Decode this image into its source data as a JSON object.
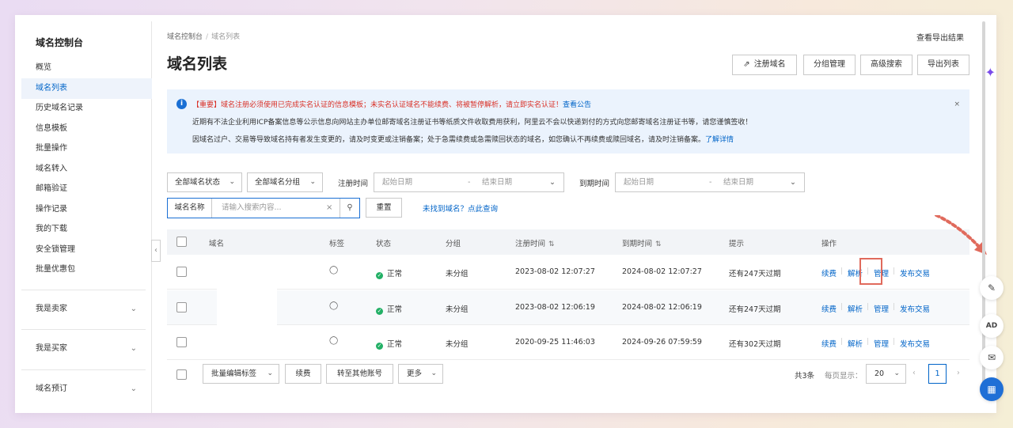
{
  "sidebar": {
    "title": "域名控制台",
    "items": [
      {
        "label": "概览"
      },
      {
        "label": "域名列表"
      },
      {
        "label": "历史域名记录"
      },
      {
        "label": "信息模板"
      },
      {
        "label": "批量操作"
      },
      {
        "label": "域名转入"
      },
      {
        "label": "邮箱验证"
      },
      {
        "label": "操作记录"
      },
      {
        "label": "我的下载"
      },
      {
        "label": "安全锁管理"
      },
      {
        "label": "批量优惠包"
      }
    ],
    "groups": [
      {
        "label": "我是卖家"
      },
      {
        "label": "我是买家"
      },
      {
        "label": "域名预订"
      }
    ]
  },
  "breadcrumb": {
    "root": "域名控制台",
    "current": "域名列表"
  },
  "header": {
    "export_results": "查看导出结果",
    "title": "域名列表",
    "buttons": {
      "register": "注册域名",
      "group": "分组管理",
      "advanced": "高级搜索",
      "export": "导出列表"
    }
  },
  "notice": {
    "line1_red": "【重要】域名注册必须使用已完成实名认证的信息模板；未实名认证域名不能续费、将被暂停解析，请立即实名认证！",
    "line1_link": "查看公告",
    "line2": "近期有不法企业利用ICP备案信息等公示信息向网站主办单位邮寄域名注册证书等纸质文件收取费用获利，阿里云不会以快递到付的方式向您邮寄域名注册证书等，请您谨慎签收！",
    "line3": "因域名过户、交易等导致域名持有者发生变更的，请及时变更或注销备案；处于急需续费或急需赎回状态的域名，如您确认不再续费或赎回域名，请及时注销备案。",
    "line3_link": "了解详情",
    "close": "×"
  },
  "filters": {
    "status": "全部域名状态",
    "group": "全部域名分组",
    "reg_time_label": "注册时间",
    "exp_time_label": "到期时间",
    "start_placeholder": "起始日期",
    "end_placeholder": "结束日期",
    "range_sep": "-",
    "search_prefix": "域名名称",
    "search_placeholder": "请输入搜索内容...",
    "reset": "重置",
    "not_found_link": "未找到域名？点此查询"
  },
  "table": {
    "headers": {
      "domain": "域名",
      "tag": "标签",
      "status": "状态",
      "group": "分组",
      "reg_time": "注册时间",
      "exp_time": "到期时间",
      "hint": "提示",
      "action": "操作"
    },
    "rows": [
      {
        "status": "正常",
        "group": "未分组",
        "reg_time": "2023-08-02 12:07:27",
        "exp_time": "2024-08-02 12:07:27",
        "hint": "还有247天过期"
      },
      {
        "status": "正常",
        "group": "未分组",
        "reg_time": "2023-08-02 12:06:19",
        "exp_time": "2024-08-02 12:06:19",
        "hint": "还有247天过期"
      },
      {
        "status": "正常",
        "group": "未分组",
        "reg_time": "2020-09-25 11:46:03",
        "exp_time": "2024-09-26 07:59:59",
        "hint": "还有302天过期"
      }
    ],
    "actions": {
      "renew": "续费",
      "resolve": "解析",
      "manage": "管理",
      "trade": "发布交易"
    }
  },
  "footer": {
    "batch_tag": "批量编辑标签",
    "renew": "续费",
    "transfer": "转至其他账号",
    "more": "更多",
    "total": "共3条",
    "per_page_label": "每页显示：",
    "per_page": "20",
    "page": "1"
  },
  "colors": {
    "accent": "#0064c8",
    "highlight": "#e06a5c",
    "notice_bg": "#ebf3fd"
  }
}
